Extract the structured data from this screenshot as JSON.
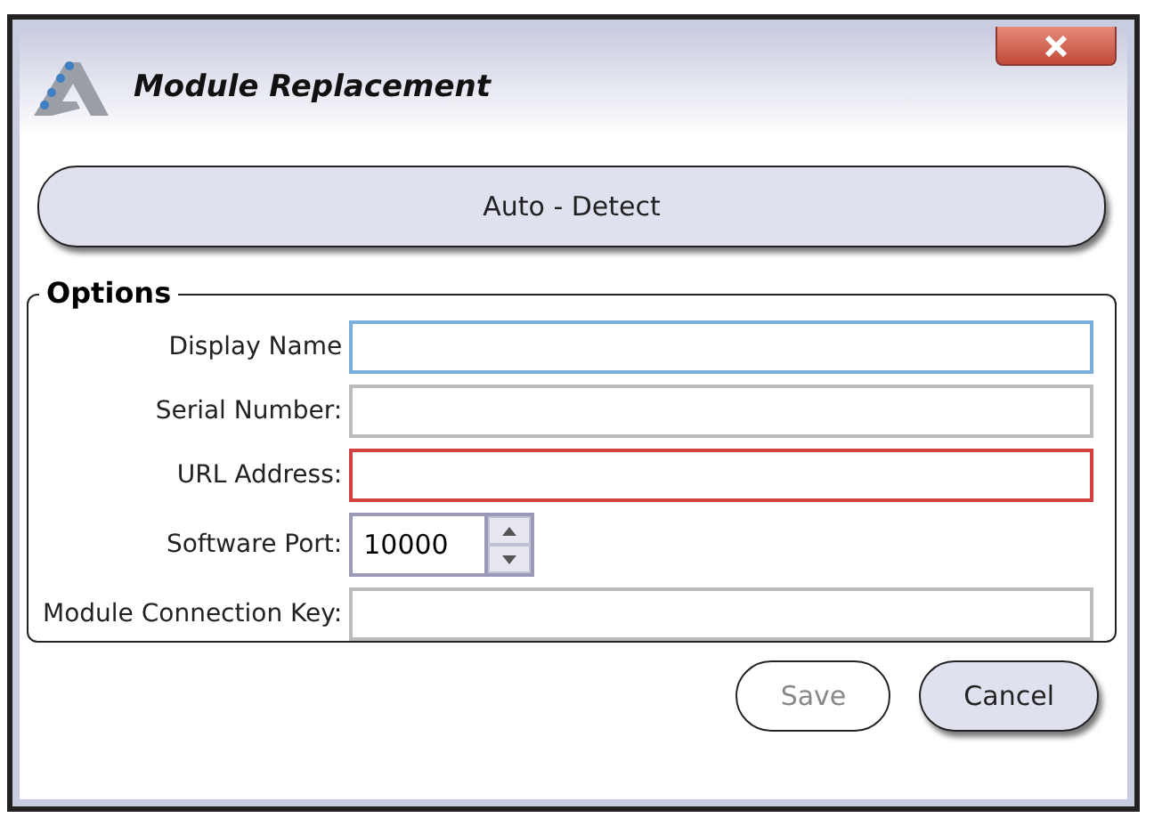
{
  "window": {
    "title": "Module Replacement"
  },
  "auto_detect_button": {
    "label": "Auto - Detect"
  },
  "options": {
    "title": "Options",
    "fields": [
      {
        "label": "Display Name",
        "kind": "text",
        "focused": true,
        "invalid": false
      },
      {
        "label": "Serial Number:",
        "kind": "text",
        "focused": false,
        "invalid": false
      },
      {
        "label": "URL Address:",
        "kind": "text",
        "focused": false,
        "invalid": true
      },
      {
        "label": "Software Port:",
        "kind": "spinner",
        "focused": false,
        "invalid": false,
        "value": "10000"
      },
      {
        "label": "Module Connection Key:",
        "kind": "text",
        "focused": false,
        "invalid": false
      }
    ]
  },
  "buttons": [
    {
      "label": "Save",
      "disabled": true
    },
    {
      "label": "Cancel",
      "disabled": false
    }
  ]
}
